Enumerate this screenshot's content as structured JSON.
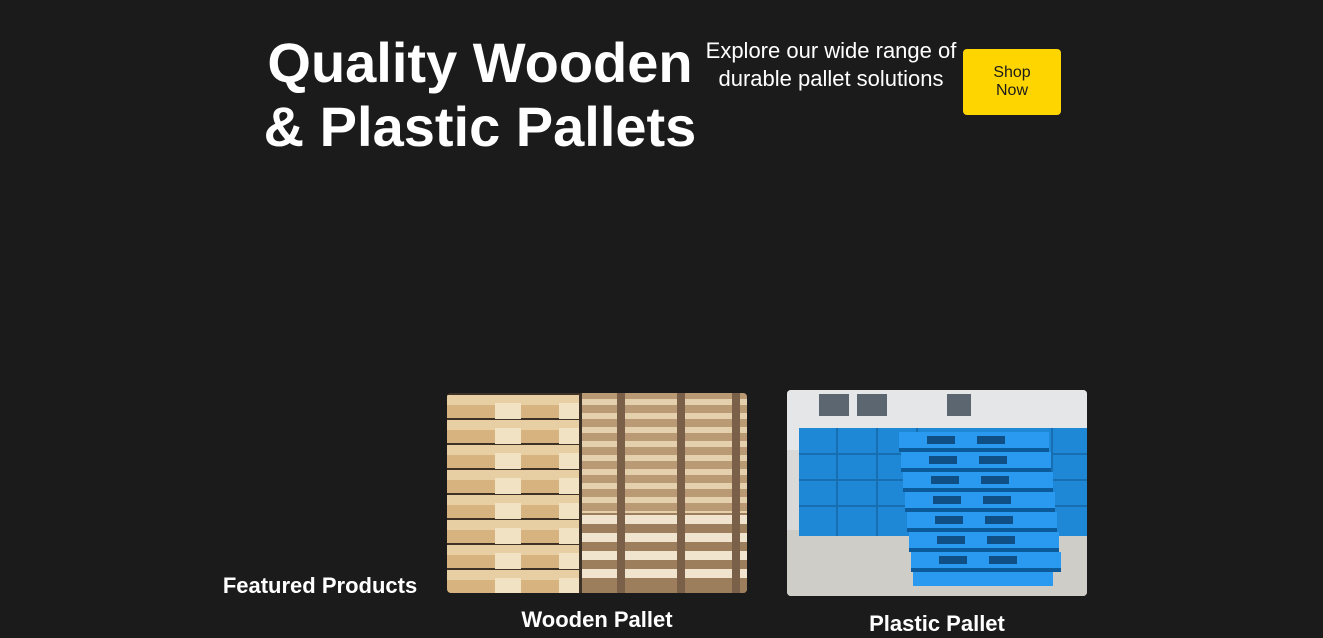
{
  "hero": {
    "title": "Quality Wooden & Plastic Pallets",
    "subtitle": "Explore our wide range of durable pallet solutions",
    "cta_label": "Shop Now"
  },
  "featured": {
    "heading": "Featured Products",
    "products": [
      {
        "name": "Wooden Pallet",
        "image": "stacked-wooden-pallets-photo"
      },
      {
        "name": "Plastic Pallet",
        "image": "stacked-blue-plastic-pallets-photo"
      }
    ]
  },
  "colors": {
    "background": "#1b1b1b",
    "text": "#ffffff",
    "accent": "#ffd500"
  }
}
